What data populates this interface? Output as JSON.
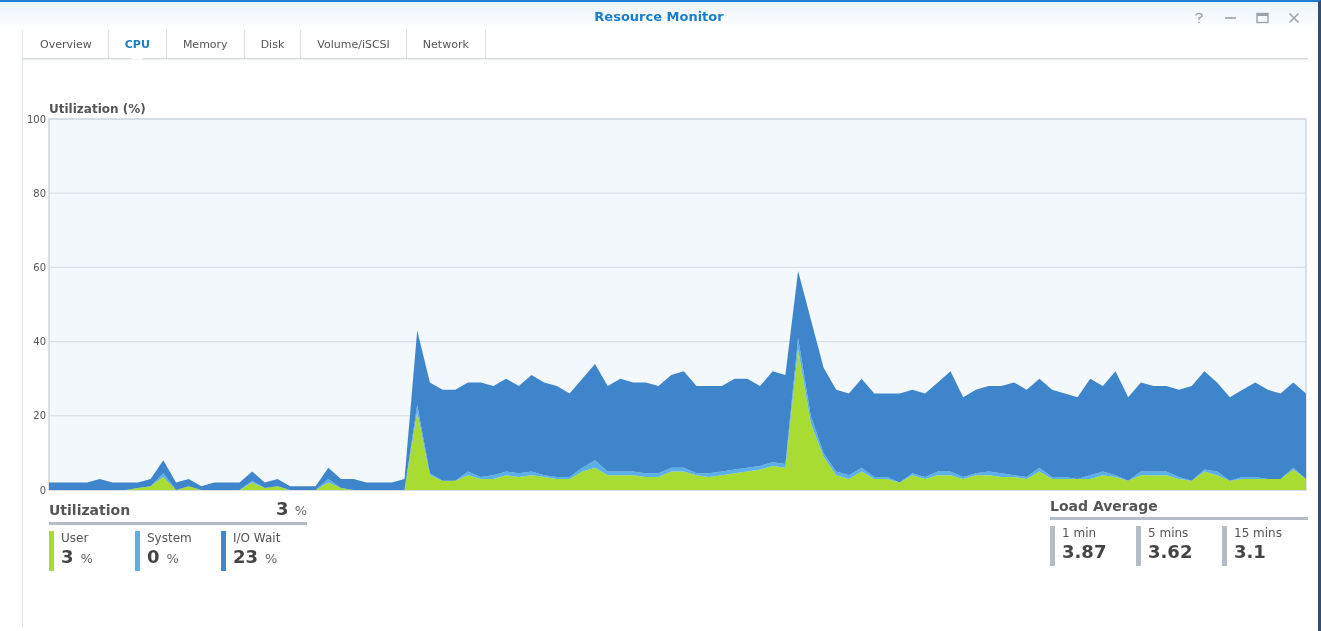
{
  "window": {
    "title": "Resource Monitor"
  },
  "tabs": [
    {
      "label": "Overview",
      "selected": false
    },
    {
      "label": "CPU",
      "selected": true
    },
    {
      "label": "Memory",
      "selected": false
    },
    {
      "label": "Disk",
      "selected": false
    },
    {
      "label": "Volume/iSCSI",
      "selected": false
    },
    {
      "label": "Network",
      "selected": false
    }
  ],
  "chart_data": {
    "type": "area",
    "title": "Utilization (%)",
    "stacked": true,
    "grid": true,
    "ylim": [
      0,
      100
    ],
    "yticks": [
      0,
      20,
      40,
      60,
      80,
      100
    ],
    "series": [
      {
        "name": "User",
        "color": "#a8dc32",
        "values": [
          0,
          0,
          0,
          0,
          0,
          0,
          0,
          0.5,
          1,
          3.5,
          0,
          1,
          0,
          0,
          0,
          0,
          2,
          0.5,
          1,
          0,
          0,
          0,
          2,
          0.5,
          0,
          0,
          0,
          0,
          0,
          21,
          4,
          2.5,
          2.5,
          4,
          3,
          3,
          4,
          3.5,
          4,
          3.5,
          3,
          3,
          5,
          6,
          4,
          4,
          4,
          3.5,
          3.5,
          5,
          5,
          4,
          3.5,
          4,
          4.5,
          5,
          5.5,
          6.5,
          6,
          38,
          18,
          9,
          4,
          3,
          5,
          3,
          3,
          2,
          4,
          3,
          4,
          4,
          3,
          4,
          4,
          3.5,
          3.5,
          3,
          5,
          3,
          3,
          3,
          3,
          4,
          3.5,
          2.5,
          4,
          4,
          4,
          3,
          2.5,
          5,
          4,
          2.5,
          3,
          3,
          3,
          3,
          5.5,
          3
        ]
      },
      {
        "name": "System",
        "color": "#5cb0e8",
        "values": [
          0,
          0,
          0,
          0,
          0,
          0,
          0,
          0,
          0,
          1,
          0,
          0,
          0,
          0,
          0,
          0,
          0.5,
          0,
          0,
          0,
          0,
          0,
          1,
          0,
          0,
          0,
          0,
          0,
          0,
          2,
          0.5,
          0,
          0,
          1,
          0.5,
          1,
          1,
          1,
          1,
          0.5,
          0.5,
          0.5,
          1,
          2,
          1,
          1,
          1,
          1,
          1,
          1,
          1,
          0.5,
          1,
          1,
          1,
          1,
          1,
          1,
          1,
          3,
          2,
          1,
          1,
          1,
          1,
          0.5,
          0.5,
          0,
          0.5,
          0.5,
          1,
          1,
          0.5,
          0.5,
          1,
          1,
          0.5,
          0.5,
          1,
          0.5,
          0.5,
          0,
          1,
          1,
          0.5,
          0,
          1,
          1,
          1,
          0.5,
          0,
          0.5,
          1,
          0,
          0.5,
          0.5,
          0,
          0,
          0.5,
          0
        ]
      },
      {
        "name": "I/O Wait",
        "color": "#3e85cb",
        "values": [
          2,
          2,
          2,
          2,
          3,
          2,
          2,
          1.5,
          2,
          3.5,
          2,
          2,
          1,
          2,
          2,
          2,
          2.5,
          1.5,
          2,
          1,
          1,
          1,
          3,
          2.5,
          3,
          2,
          2,
          2,
          3,
          20,
          24.5,
          24.5,
          24.5,
          24,
          25.5,
          24,
          25,
          23.5,
          26,
          25,
          24.5,
          22.5,
          24,
          26,
          23,
          25,
          24,
          24.5,
          23.5,
          25,
          26,
          23.5,
          23.5,
          23,
          24.5,
          24,
          21.5,
          24.5,
          24,
          18,
          26,
          23,
          22,
          22,
          24,
          22.5,
          22.5,
          24,
          22.5,
          22.5,
          24,
          27,
          21.5,
          22.5,
          23,
          23.5,
          25,
          23.5,
          24,
          23.5,
          22.5,
          22,
          26,
          23,
          28,
          22.5,
          24,
          23,
          23,
          23.5,
          25.5,
          26.5,
          24,
          22.5,
          23.5,
          25.5,
          24,
          23,
          23,
          23
        ]
      }
    ]
  },
  "utilization": {
    "title": "Utilization",
    "total": "3",
    "unit": "%",
    "items": [
      {
        "value": "3",
        "unit": "%"
      },
      {
        "value": "0",
        "unit": "%"
      },
      {
        "value": "23",
        "unit": "%"
      }
    ]
  },
  "load_average": {
    "title": "Load Average",
    "items": [
      {
        "label": "1 min",
        "value": "3.87"
      },
      {
        "label": "5 mins",
        "value": "3.62"
      },
      {
        "label": "15 mins",
        "value": "3.1"
      }
    ]
  }
}
